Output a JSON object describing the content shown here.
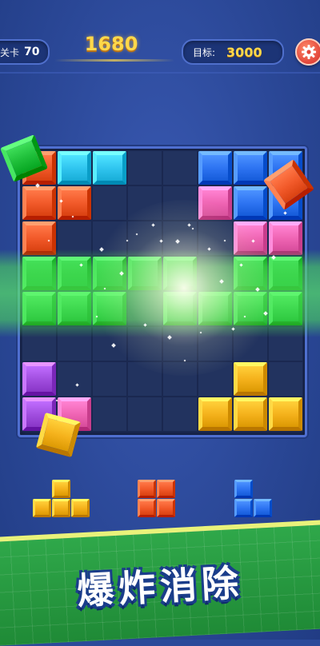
{
  "header": {
    "level_label": "关卡",
    "level_value": "70",
    "score": "1680",
    "target_label": "目标:",
    "target_value": "3000",
    "settings_icon": "gear-icon"
  },
  "banner": {
    "text": "爆炸消除"
  },
  "colors": {
    "red": "#f25a2a",
    "cyan": "#31c6f0",
    "blue": "#2e74f2",
    "pink": "#f065b4",
    "green": "#1fbf3a",
    "purple": "#a24fe0",
    "yellow": "#f5b21c",
    "empty": "#22335f"
  },
  "board": {
    "cols": 8,
    "rows": 8,
    "cells": [
      "red cyan cyan . . blue blue blue",
      "red red . . . pink blue blue",
      "red . . . . . pink pink",
      "green green green green green . green green",
      "green green green . green green green green",
      ". . . . . . . .",
      "purple . . . . . yellow .",
      "purple pink . . . yellow yellow yellow"
    ]
  },
  "tray": [
    {
      "name": "tray-piece-yellow-t",
      "color": "yellow",
      "shape": [
        "0,1",
        "1,0",
        "1,1",
        "1,2"
      ]
    },
    {
      "name": "tray-piece-red-square",
      "color": "red",
      "shape": [
        "0,0",
        "0,1",
        "1,0",
        "1,1"
      ]
    },
    {
      "name": "tray-piece-blue-corner",
      "color": "blue",
      "shape": [
        "0,0",
        "1,0",
        "1,1"
      ]
    }
  ]
}
